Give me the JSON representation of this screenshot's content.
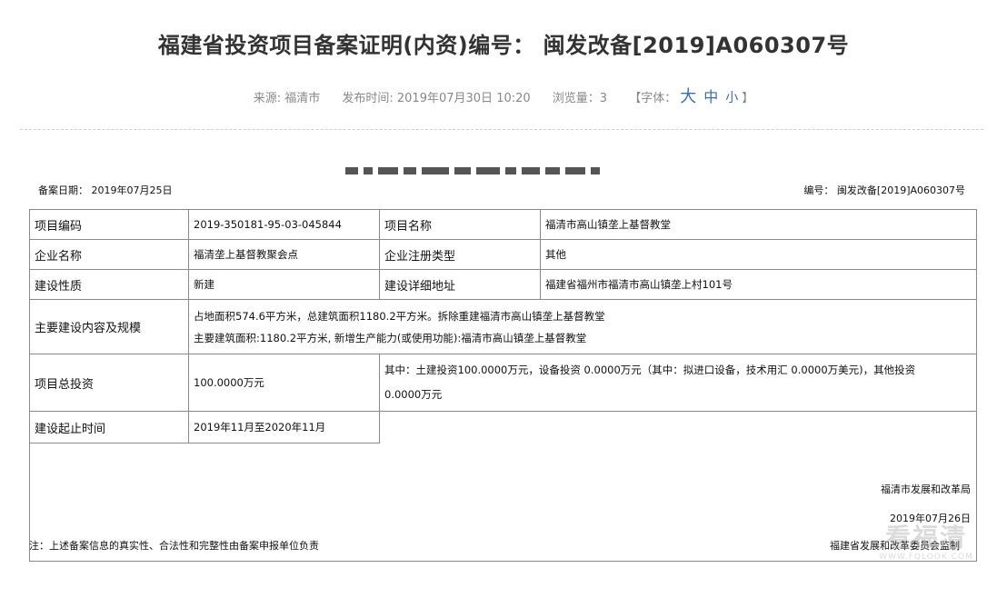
{
  "article": {
    "title": "福建省投资项目备案证明(内资)编号： 闽发改备[2019]A060307号",
    "source": "来源: 福清市",
    "publish_time": "发布时间: 2019年07月30日 10:20",
    "views": "浏览量：3",
    "font_size_prefix": "【字体：",
    "font_size_options": [
      "大",
      "中",
      "小"
    ],
    "font_size_suffix": "】"
  },
  "document": {
    "record_date": "备案日期： 2019年07月25日",
    "record_number": "编号： 闽发改备[2019]A060307号",
    "rows": [
      {
        "label": "项目编码",
        "value": "2019-350181-95-03-045844",
        "label2": "项目名称",
        "value2": "福清市高山镇垄上基督教堂"
      },
      {
        "label": "企业名称",
        "value": "福清垄上基督教聚会点",
        "label2": "企业注册类型",
        "value2": "其他"
      },
      {
        "label": "建设性质",
        "value": "新建",
        "label2": "建设详细地址",
        "value2": "福建省福州市福清市高山镇垄上村101号"
      }
    ],
    "scale": {
      "label": "主要建设内容及规模",
      "line1": "占地面积574.6平方米，总建筑面积1180.2平方米。拆除重建福清市高山镇垄上基督教堂",
      "line2": "主要建筑面积:1180.2平方米, 新增生产能力(或使用功能):福清市高山镇垄上基督教堂"
    },
    "investment": {
      "label": "项目总投资",
      "value": "100.0000万元",
      "detail_line1": "其中：土建投资100.0000万元，设备投资 0.0000万元（其中：拟进口设备，技术用汇 0.0000万美元)，其他投资",
      "detail_line2": "0.0000万元"
    },
    "period": {
      "label": "建设起止时间",
      "value": "2019年11月至2020年11月"
    },
    "signature": {
      "org": "福清市发展和改革局",
      "date": "2019年07月26日"
    },
    "footnote": "注：上述备案信息的真实性、合法性和完整性由备案申报单位负责",
    "supervisor": "福建省发展和改革委员会监制"
  },
  "watermark": {
    "main": "看福清",
    "sub": "WWW.FQLOOK.COM"
  }
}
